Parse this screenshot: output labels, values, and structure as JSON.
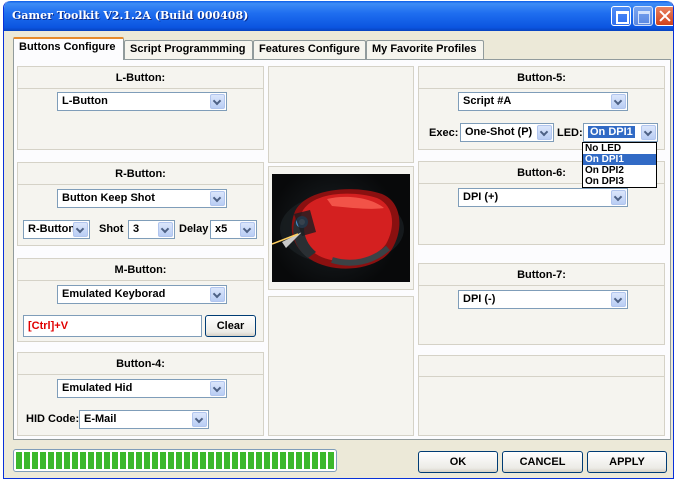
{
  "window": {
    "title": "Gamer Toolkit V2.1.2A (Build 000408)"
  },
  "tabs": [
    {
      "label": "Buttons Configure",
      "active": true
    },
    {
      "label": "Script Programmming",
      "active": false
    },
    {
      "label": "Features Configure",
      "active": false
    },
    {
      "label": "My Favorite Profiles",
      "active": false
    }
  ],
  "left": {
    "lbutton": {
      "title": "L-Button:",
      "select": "L-Button"
    },
    "rbutton": {
      "title": "R-Button:",
      "select": "Button Keep Shot",
      "button_select": "R-Button",
      "shot_label": "Shot",
      "shot_value": "3",
      "delay_label": "Delay",
      "delay_value": "x5"
    },
    "mbutton": {
      "title": "M-Button:",
      "select": "Emulated Keyborad",
      "key_text": "[Ctrl]+V",
      "clear_label": "Clear"
    },
    "button4": {
      "title": "Button-4:",
      "select": "Emulated Hid",
      "hid_label": "HID Code:",
      "hid_value": "E-Mail"
    }
  },
  "right": {
    "button5": {
      "title": "Button-5:",
      "select": "Script #A",
      "exec_label": "Exec:",
      "exec_value": "One-Shot (P)",
      "led_label": "LED:",
      "led_value": "On DPI1",
      "led_options": [
        "No LED",
        "On DPI1",
        "On DPI2",
        "On DPI3"
      ],
      "led_selected_index": 1
    },
    "button6": {
      "title": "Button-6:",
      "select": "DPI (+)"
    },
    "button7": {
      "title": "Button-7:",
      "select": "DPI (-)"
    }
  },
  "footer": {
    "progress": 1.0,
    "ok_label": "OK",
    "cancel_label": "CANCEL",
    "apply_label": "APPLY"
  },
  "colors": {
    "titlebar": "#1f6ef0",
    "tab_accent": "#e68b2c",
    "progress": "#3cb82c",
    "selection": "#316ac5",
    "key_text": "#e00000"
  }
}
